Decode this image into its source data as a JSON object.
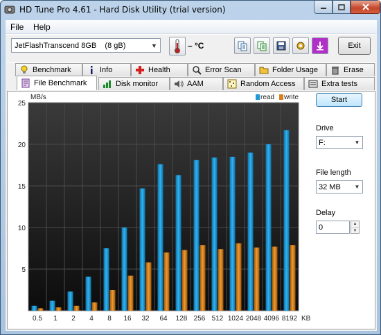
{
  "window": {
    "title": "HD Tune Pro 4.61 - Hard Disk Utility (trial version)"
  },
  "menu": {
    "file": "File",
    "help": "Help"
  },
  "toolbar": {
    "drive": "JetFlashTranscend 8GB    (8 gB)",
    "temperature": "– °C",
    "exit_label": "Exit",
    "buttons": [
      "copy-info-icon",
      "copy-text-icon",
      "save-icon",
      "options-icon",
      "screenshot-icon"
    ]
  },
  "tabs_row1": [
    {
      "label": "Benchmark",
      "icon": "benchmark-bulb-icon"
    },
    {
      "label": "Info",
      "icon": "info-icon"
    },
    {
      "label": "Health",
      "icon": "health-cross-icon"
    },
    {
      "label": "Error Scan",
      "icon": "error-scan-icon"
    },
    {
      "label": "Folder Usage",
      "icon": "folder-icon"
    },
    {
      "label": "Erase",
      "icon": "trash-icon"
    }
  ],
  "tabs_row2": [
    {
      "label": "File Benchmark",
      "icon": "file-benchmark-icon"
    },
    {
      "label": "Disk monitor",
      "icon": "disk-monitor-icon"
    },
    {
      "label": "AAM",
      "icon": "speaker-icon"
    },
    {
      "label": "Random Access",
      "icon": "random-access-icon"
    },
    {
      "label": "Extra tests",
      "icon": "extra-tests-icon"
    }
  ],
  "controls": {
    "start_label": "Start",
    "drive_label": "Drive",
    "drive_value": "F:",
    "file_length_label": "File length",
    "file_length_value": "32 MB",
    "delay_label": "Delay",
    "delay_value": "0"
  },
  "colors": {
    "read": "#1e9bd6",
    "write": "#d9801c",
    "plot_bg": "#101010"
  },
  "chart_data": {
    "type": "bar",
    "categories": [
      "0.5",
      "1",
      "2",
      "4",
      "8",
      "16",
      "32",
      "64",
      "128",
      "256",
      "512",
      "1024",
      "2048",
      "4096",
      "8192"
    ],
    "x_unit": "KB",
    "ylabel": "MB/s",
    "ylim": [
      0,
      25
    ],
    "yticks": [
      5,
      10,
      15,
      20,
      25
    ],
    "grid": true,
    "legend_position": "top-right",
    "series": [
      {
        "name": "read",
        "values": [
          0.6,
          1.2,
          2.3,
          4.1,
          7.5,
          10.0,
          14.7,
          17.6,
          16.3,
          18.1,
          18.4,
          18.5,
          19.0,
          20.0,
          21.7
        ]
      },
      {
        "name": "write",
        "values": [
          0.3,
          0.4,
          0.6,
          1.0,
          2.5,
          4.2,
          5.8,
          7.0,
          7.3,
          7.9,
          7.4,
          8.1,
          7.6,
          7.7,
          7.9
        ]
      }
    ]
  }
}
